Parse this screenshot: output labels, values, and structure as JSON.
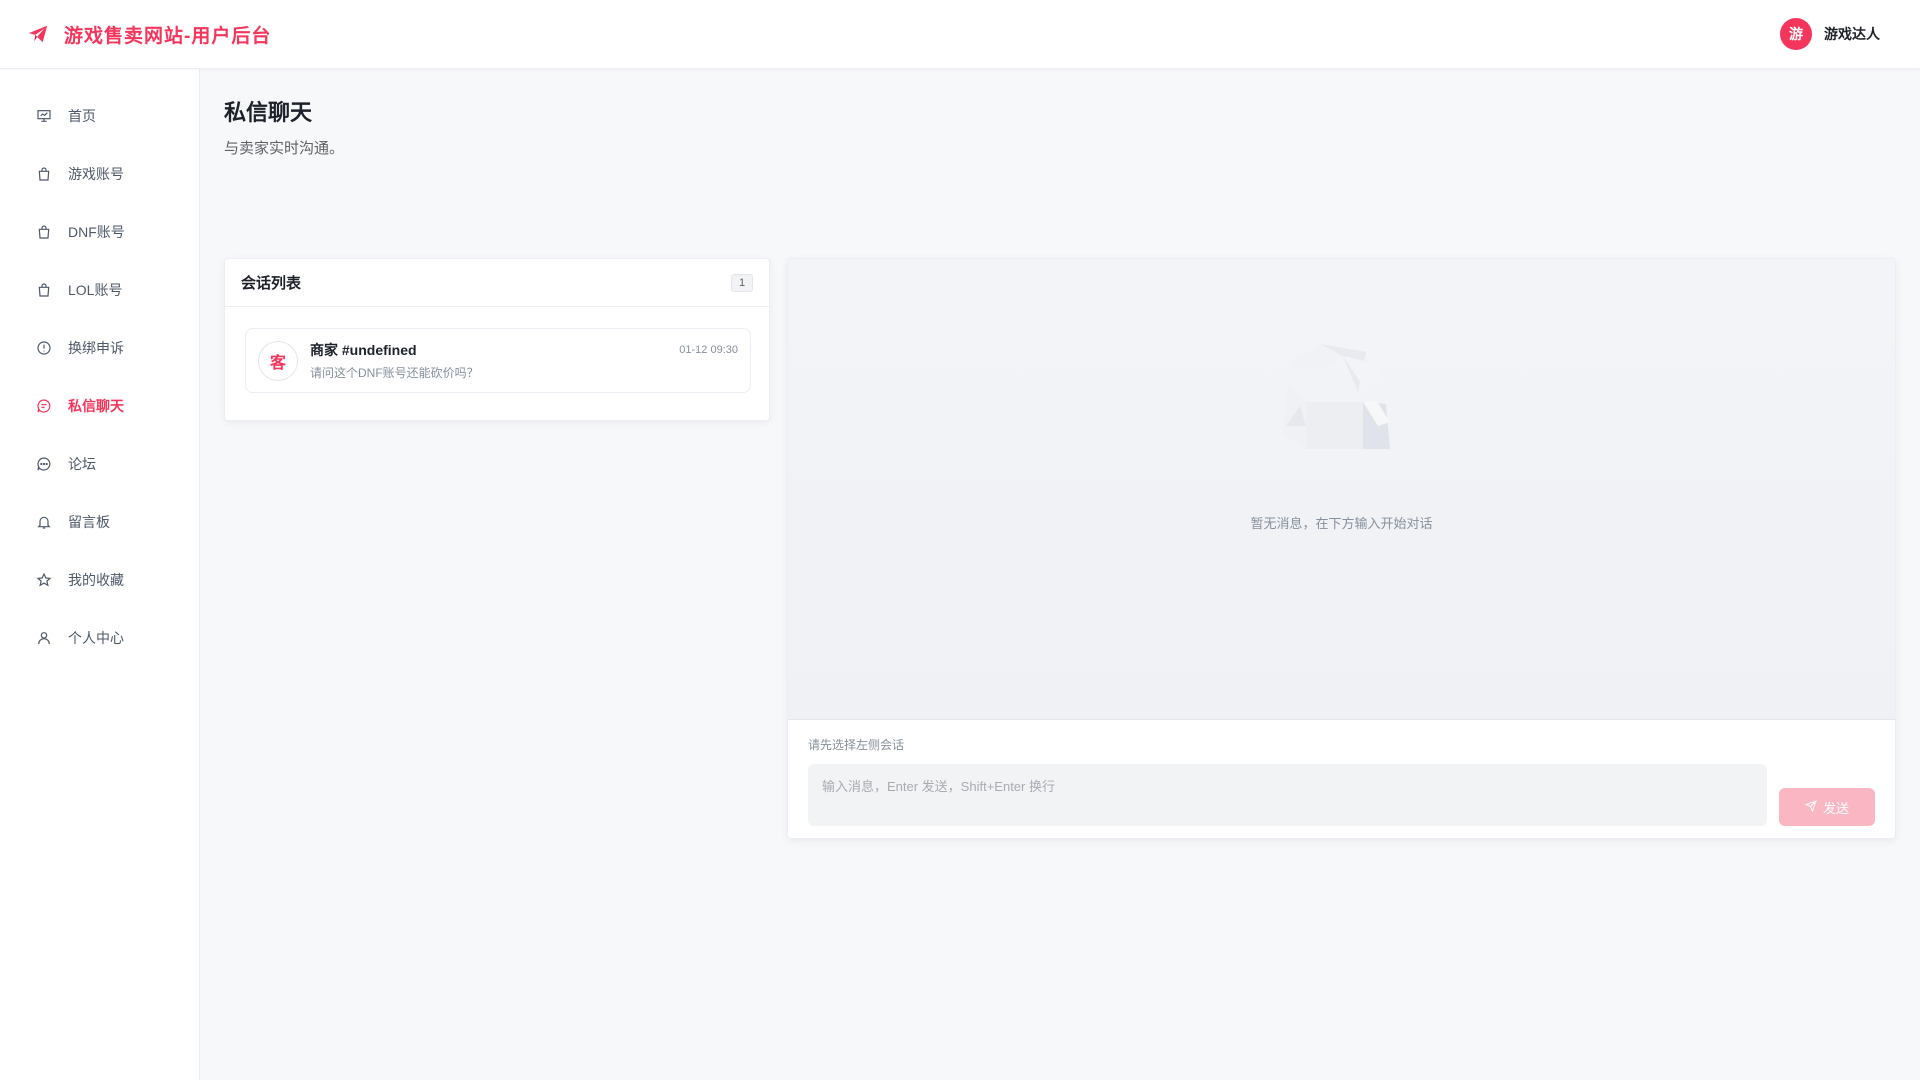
{
  "header": {
    "brand_title": "游戏售卖网站-用户后台",
    "user_avatar_text": "游",
    "user_name": "游戏达人"
  },
  "sidebar": {
    "items": [
      {
        "label": "首页",
        "icon": "presentation-icon"
      },
      {
        "label": "游戏账号",
        "icon": "shopping-bag-icon"
      },
      {
        "label": "DNF账号",
        "icon": "shopping-bag-icon"
      },
      {
        "label": "LOL账号",
        "icon": "shopping-bag-icon"
      },
      {
        "label": "换绑申诉",
        "icon": "alert-circle-icon"
      },
      {
        "label": "私信聊天",
        "icon": "chat-icon",
        "active": true
      },
      {
        "label": "论坛",
        "icon": "message-dots-icon"
      },
      {
        "label": "留言板",
        "icon": "bell-icon"
      },
      {
        "label": "我的收藏",
        "icon": "star-icon"
      },
      {
        "label": "个人中心",
        "icon": "user-icon"
      }
    ]
  },
  "page": {
    "title": "私信聊天",
    "subtitle": "与卖家实时沟通。"
  },
  "conversations": {
    "title": "会话列表",
    "count": "1",
    "items": [
      {
        "avatar_text": "客",
        "name": "商家 #undefined",
        "time": "01-12 09:30",
        "preview": "请问这个DNF账号还能砍价吗？"
      }
    ]
  },
  "chat": {
    "empty_text": "暂无消息，在下方输入开始对话",
    "hint": "请先选择左侧会话",
    "input_placeholder": "输入消息，Enter 发送，Shift+Enter 换行",
    "send_label": "发送"
  },
  "colors": {
    "accent": "#f5365c",
    "send_disabled": "#fab6c3"
  }
}
